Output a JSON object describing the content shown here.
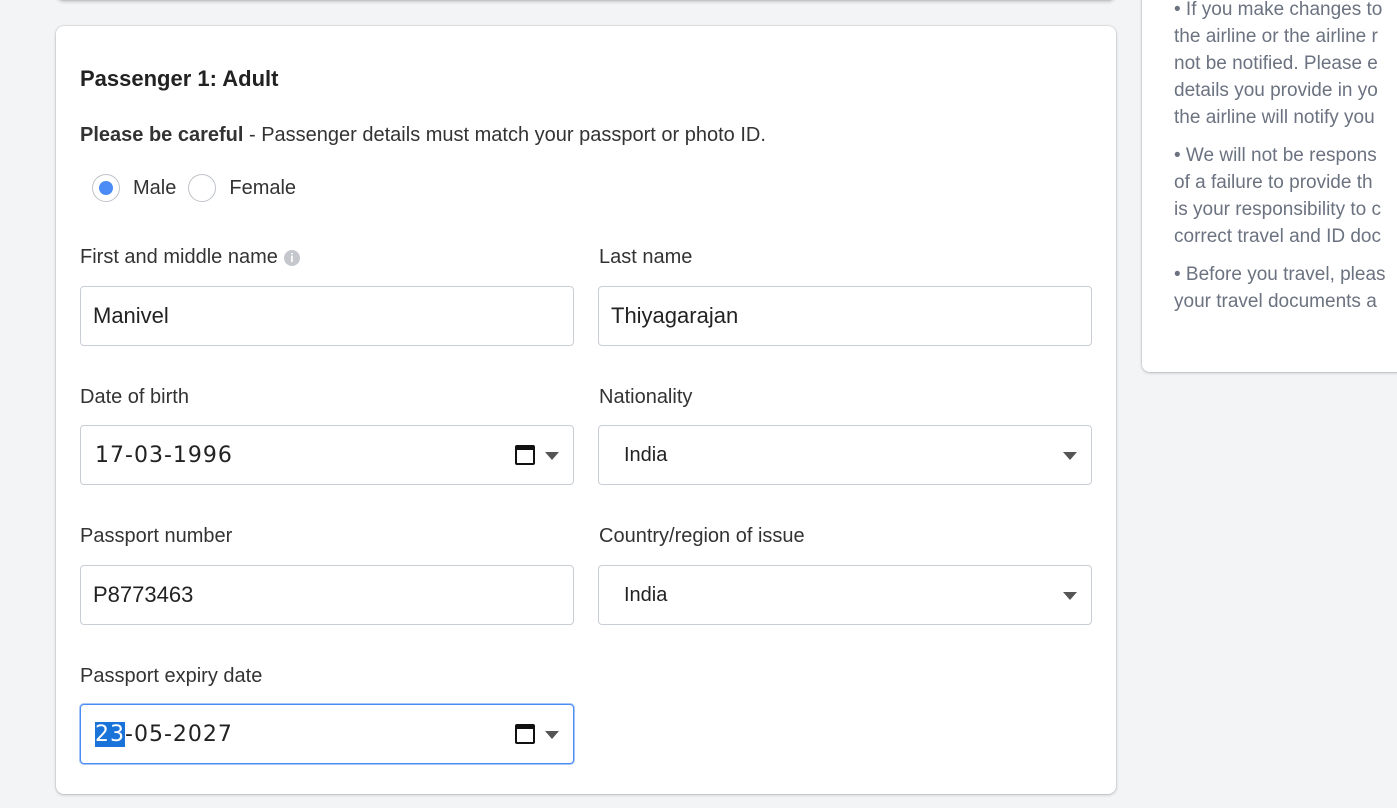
{
  "passenger": {
    "title": "Passenger 1: Adult",
    "notice_bold": "Please be careful",
    "notice_text": " - Passenger details must match your passport or photo ID.",
    "gender_options": [
      {
        "label": "Male",
        "selected": true
      },
      {
        "label": "Female",
        "selected": false
      }
    ],
    "first_name": {
      "label": "First and middle name",
      "value": "Manivel"
    },
    "last_name": {
      "label": "Last name",
      "value": "Thiyagarajan"
    },
    "dob": {
      "label": "Date of birth",
      "day": "17",
      "month": "03",
      "year": "1996",
      "sep": "-"
    },
    "nationality": {
      "label": "Nationality",
      "value": "India"
    },
    "passport_number": {
      "label": "Passport number",
      "value": "P8773463"
    },
    "issue_country": {
      "label": "Country/region of issue",
      "value": "India"
    },
    "expiry": {
      "label": "Passport expiry date",
      "day": "23",
      "month": "05",
      "year": "2027",
      "sep": "-"
    }
  },
  "sidebar": {
    "lines": [
      [
        "• If you make changes to",
        "the airline or the airline r",
        "not be notified. Please e",
        "details you provide in yo",
        "the airline will notify you"
      ],
      [
        "• We will not be respons",
        "of a failure to provide th",
        "is your responsibility to c",
        "correct travel and ID doc"
      ],
      [
        "• Before you travel, pleas",
        "your travel documents a"
      ]
    ]
  },
  "colors": {
    "accent": "#4b8bf5",
    "selection": "#1a73d9",
    "muted_text": "#6b7280"
  },
  "icons": {
    "info": "info-icon",
    "calendar": "calendar-icon",
    "dropdown": "chevron-down-icon"
  }
}
